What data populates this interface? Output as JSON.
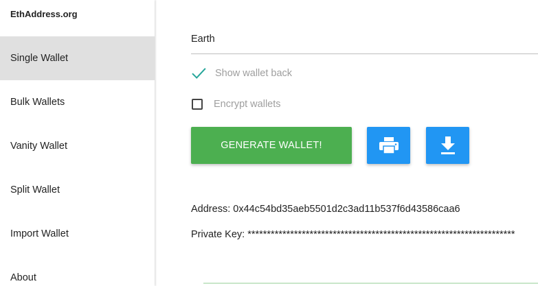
{
  "sidebar": {
    "brand": "EthAddress.org",
    "items": [
      {
        "label": "Single Wallet",
        "active": true
      },
      {
        "label": "Bulk Wallets",
        "active": false
      },
      {
        "label": "Vanity Wallet",
        "active": false
      },
      {
        "label": "Split Wallet",
        "active": false
      },
      {
        "label": "Import Wallet",
        "active": false
      },
      {
        "label": "About",
        "active": false
      }
    ]
  },
  "main": {
    "name_field": {
      "value": "Earth"
    },
    "options": {
      "show_wallet_back": {
        "label": "Show wallet back",
        "checked": true
      },
      "encrypt_wallets": {
        "label": "Encrypt wallets",
        "checked": false
      }
    },
    "buttons": {
      "generate_label": "GENERATE WALLET!",
      "print_icon": "printer-icon",
      "download_icon": "download-icon"
    },
    "address": "Address: 0x44c54bd35aeb5501d2c3ad11b537f6d43586caa6",
    "private_key": "Private Key: *********************************************************************"
  },
  "colors": {
    "generate_button": "#4caf50",
    "action_buttons": "#2196f3",
    "check_mark": "#26a69a",
    "active_nav": "#e0e0e0"
  }
}
